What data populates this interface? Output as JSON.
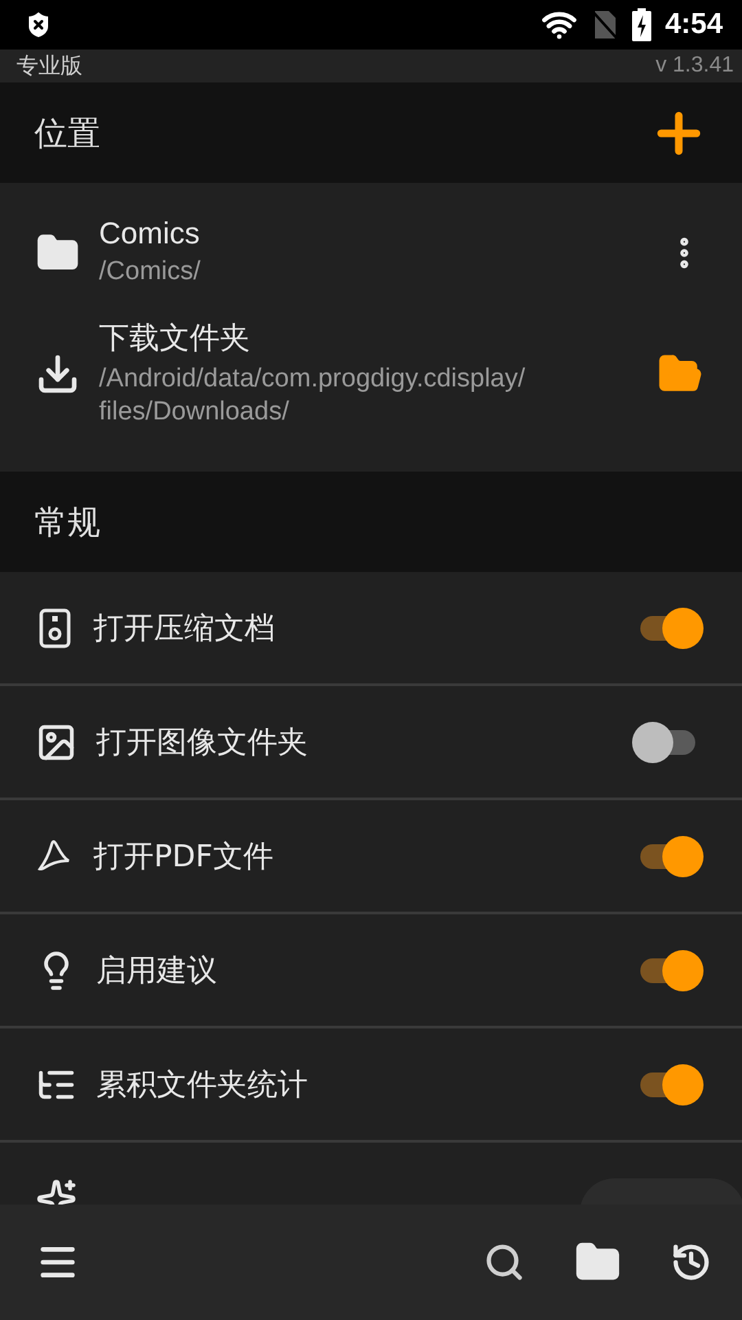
{
  "status_bar": {
    "time": "4:54"
  },
  "pro_bar": {
    "edition": "专业版",
    "version": "v 1.3.41"
  },
  "locations": {
    "title": "位置",
    "items": [
      {
        "kind": "folder",
        "name": "Comics",
        "path": "/Comics/"
      },
      {
        "kind": "download",
        "name": "下载文件夹",
        "path": "/Android/data/com.progdigy.cdisplay/files/Downloads/"
      }
    ]
  },
  "general": {
    "title": "常规",
    "settings": [
      {
        "kind": "toggle",
        "label": "打开压缩文档",
        "on": true
      },
      {
        "kind": "toggle",
        "label": "打开图像文件夹",
        "on": false
      },
      {
        "kind": "toggle",
        "label": "打开PDF文件",
        "on": true
      },
      {
        "kind": "toggle",
        "label": "启用建议",
        "on": true
      },
      {
        "kind": "toggle",
        "label": "累积文件夹统计",
        "on": true
      },
      {
        "kind": "choice"
      }
    ]
  }
}
